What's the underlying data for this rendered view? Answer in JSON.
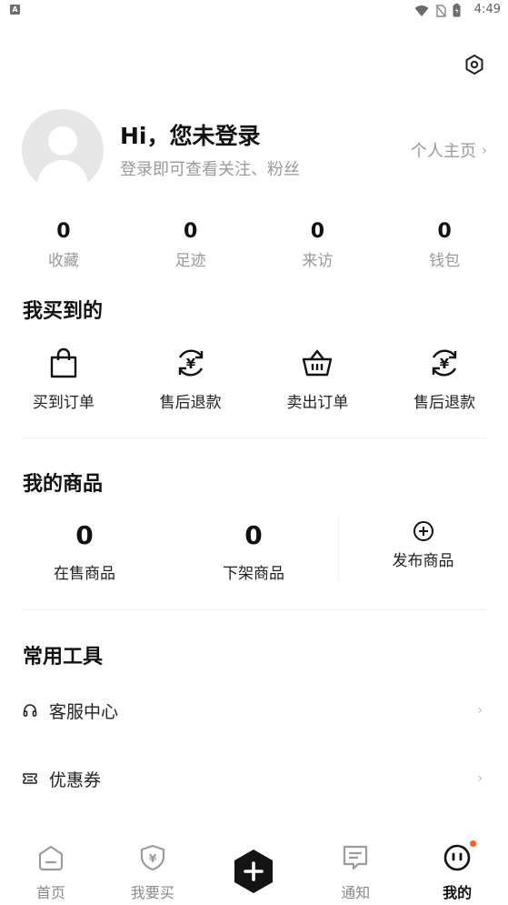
{
  "status_bar": {
    "notification_letter": "A",
    "time": "4:49",
    "icons": [
      "wifi-icon",
      "no-sim-icon",
      "battery-icon"
    ]
  },
  "header": {
    "settings_icon": "settings-hex-icon"
  },
  "profile": {
    "greeting": "Hi，您未登录",
    "subtitle": "登录即可查看关注、粉丝",
    "home_link": "个人主页",
    "home_chevron": "›"
  },
  "stats": [
    {
      "value": "0",
      "label": "收藏"
    },
    {
      "value": "0",
      "label": "足迹"
    },
    {
      "value": "0",
      "label": "来访"
    },
    {
      "value": "0",
      "label": "钱包"
    }
  ],
  "bought_section": {
    "title": "我买到的",
    "items": [
      {
        "label": "买到订单",
        "icon": "shopping-bag-icon"
      },
      {
        "label": "售后退款",
        "icon": "refund-yen-icon"
      },
      {
        "label": "卖出订单",
        "icon": "basket-icon"
      },
      {
        "label": "售后退款",
        "icon": "refund-yen-icon"
      }
    ]
  },
  "goods_section": {
    "title": "我的商品",
    "on_sale": {
      "value": "0",
      "label": "在售商品"
    },
    "off_shelf": {
      "value": "0",
      "label": "下架商品"
    },
    "publish": {
      "label": "发布商品",
      "icon": "plus-circle-icon"
    }
  },
  "tools_section": {
    "title": "常用工具",
    "items": [
      {
        "label": "客服中心",
        "icon": "headset-icon",
        "chevron": "›"
      },
      {
        "label": "优惠券",
        "icon": "coupon-icon",
        "chevron": "›"
      }
    ]
  },
  "tabbar": {
    "tabs": [
      {
        "label": "首页",
        "icon": "home-icon"
      },
      {
        "label": "我要买",
        "icon": "shield-yen-icon"
      },
      {
        "label": "",
        "icon": "publish-hex-plus-icon"
      },
      {
        "label": "通知",
        "icon": "message-icon"
      },
      {
        "label": "我的",
        "icon": "face-icon",
        "active": true
      }
    ]
  },
  "colors": {
    "accent_dot": "#ff5a1f",
    "text_primary": "#111111",
    "text_secondary": "#9a9a9a"
  }
}
